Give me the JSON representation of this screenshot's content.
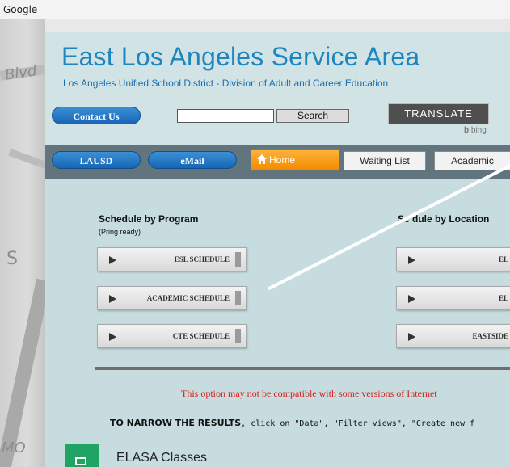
{
  "window": {
    "title": "Google"
  },
  "map": {
    "labels": [
      "Blvd",
      "S",
      "MO"
    ]
  },
  "header": {
    "title": "East Los Angeles Service Area",
    "subtitle": "Los Angeles Unified School District  - Division of Adult and Career Education",
    "contact_label": "Contact Us",
    "search_value": "",
    "search_label": "Search",
    "translate_label": "TRANSLATE",
    "bing_label": "bing"
  },
  "nav": {
    "lausd": "LAUSD",
    "email": "eMail",
    "home": "Home",
    "waiting_list": "Waiting List",
    "academic": "Academic"
  },
  "schedule_program": {
    "title": "Schedule by Program",
    "note": "(Pring ready)",
    "buttons": [
      "ESL SCHEDULE",
      "ACADEMIC SCHEDULE",
      "CTE SCHEDULE"
    ]
  },
  "schedule_location": {
    "title": "Sc  dule by Location",
    "buttons": [
      "EL",
      "EL",
      "EASTSIDE"
    ]
  },
  "notice": {
    "warning": "This option may not be compatible with some versions of Internet",
    "narrow_bold": "TO NARROW THE RESULTS",
    "narrow_rest": ", click on \"Data\", \"Filter views\", \"Create new f"
  },
  "sheet": {
    "title": "ELASA Classes"
  },
  "colors": {
    "accent_blue": "#1d86bf",
    "nav_bar": "#62757f",
    "home_orange": "#f28c00",
    "warning_red": "#d42020",
    "sheet_green": "#1fa463"
  }
}
